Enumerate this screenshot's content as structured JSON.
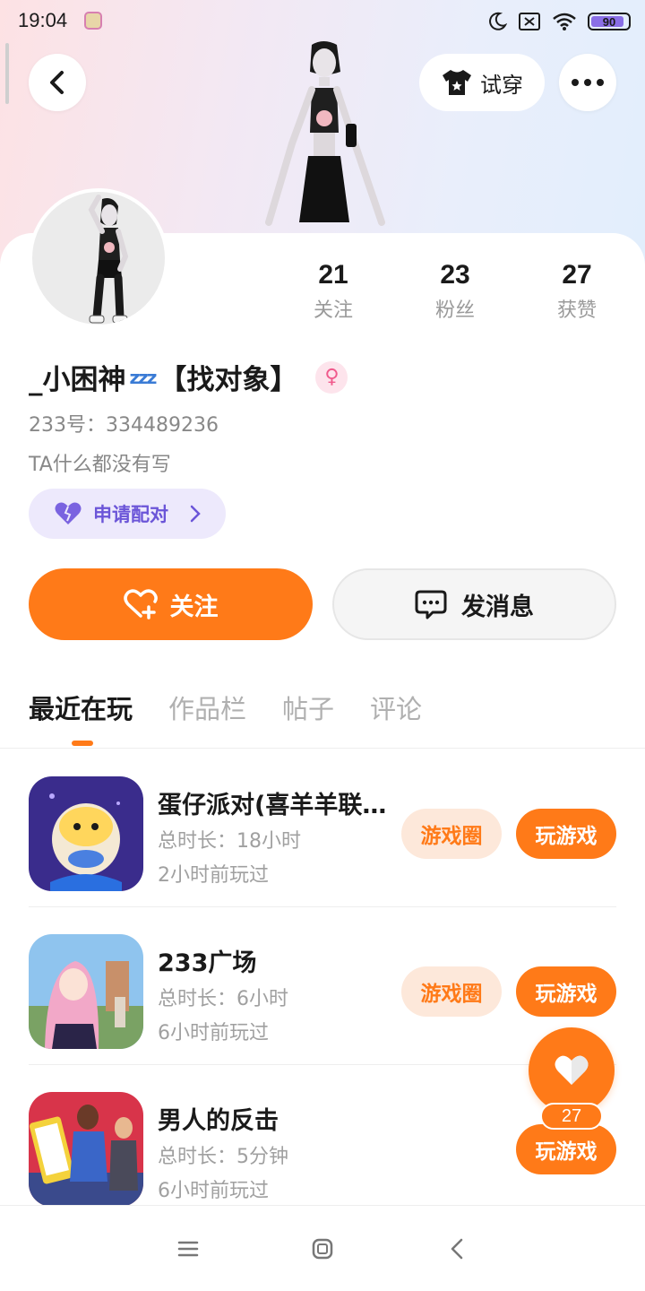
{
  "status_bar": {
    "time": "19:04",
    "battery": "90",
    "battery_level": 0.9
  },
  "header": {
    "try_on_label": "试穿"
  },
  "stats": [
    {
      "value": "21",
      "label": "关注"
    },
    {
      "value": "23",
      "label": "粉丝"
    },
    {
      "value": "27",
      "label": "获赞"
    }
  ],
  "profile": {
    "name": "_小困神",
    "name_emoji": "zzz",
    "name_tag": "【找对象】",
    "gender": "female",
    "uid": "233号：334489236",
    "bio": "TA什么都没有写",
    "pair_label": "申请配对"
  },
  "actions": {
    "follow_label": "关注",
    "message_label": "发消息"
  },
  "tabs": [
    {
      "label": "最近在玩",
      "active": true
    },
    {
      "label": "作品栏",
      "active": false
    },
    {
      "label": "帖子",
      "active": false
    },
    {
      "label": "评论",
      "active": false
    }
  ],
  "games": [
    {
      "name": "蛋仔派对(喜羊羊联动)",
      "duration": "总时长：18小时",
      "last_played": "2小时前玩过",
      "circle_label": "游戏圈",
      "play_label": "玩游戏"
    },
    {
      "name": "233广场",
      "duration": "总时长：6小时",
      "last_played": "6小时前玩过",
      "circle_label": "游戏圈",
      "play_label": "玩游戏"
    },
    {
      "name": "男人的反击",
      "duration": "总时长：5分钟",
      "last_played": "6小时前玩过",
      "play_label": "玩游戏"
    }
  ],
  "like_fab": {
    "count": "27"
  },
  "colors": {
    "accent": "#ff7a18",
    "pair_purple": "#6b55d8",
    "female_pink": "#f05a8c"
  }
}
